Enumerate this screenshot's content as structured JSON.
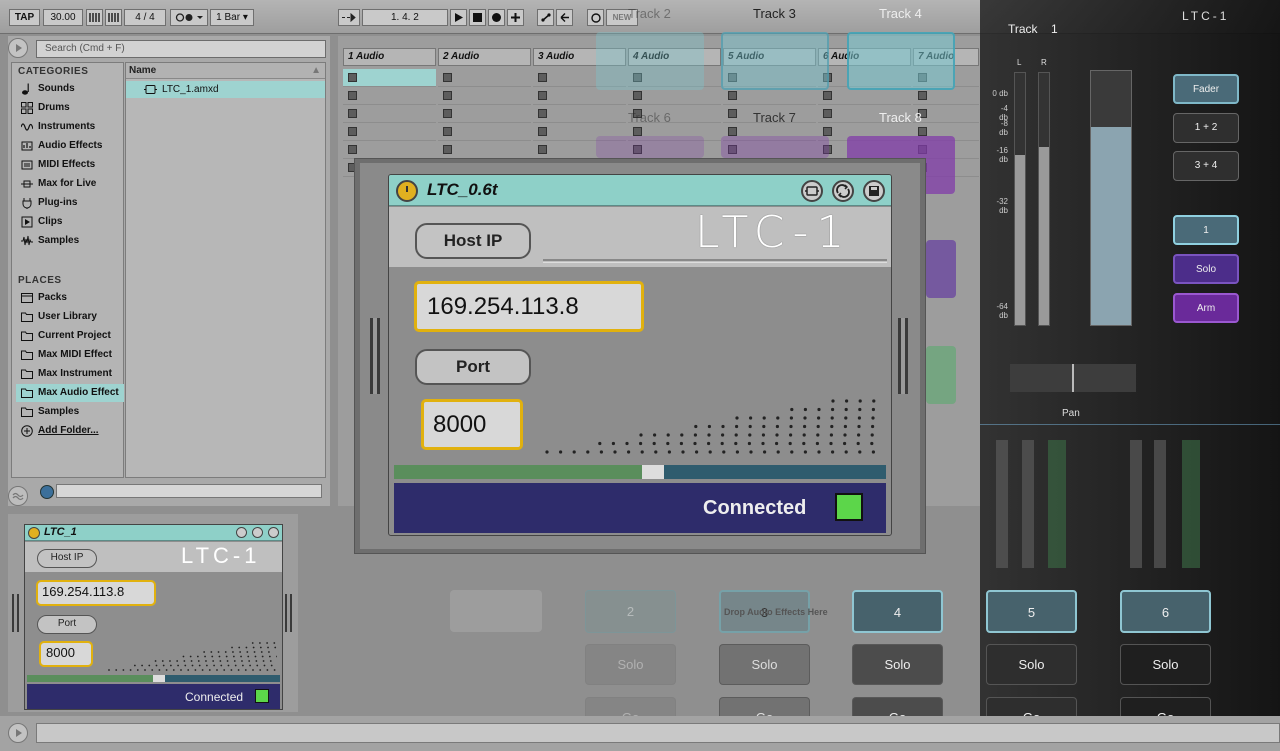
{
  "transport": {
    "tap": "TAP",
    "tempo": "30.00",
    "time_sig": "4 / 4",
    "quantize": "1 Bar",
    "position": "1.    4.    2"
  },
  "browser": {
    "search_placeholder": "Search (Cmd + F)",
    "categories_title": "CATEGORIES",
    "categories": [
      {
        "label": "Sounds",
        "icon": "note-icon"
      },
      {
        "label": "Drums",
        "icon": "drum-grid-icon"
      },
      {
        "label": "Instruments",
        "icon": "wave-icon"
      },
      {
        "label": "Audio Effects",
        "icon": "audio-effects-icon"
      },
      {
        "label": "MIDI Effects",
        "icon": "midi-effects-icon"
      },
      {
        "label": "Max for Live",
        "icon": "max-icon"
      },
      {
        "label": "Plug-ins",
        "icon": "plug-icon"
      },
      {
        "label": "Clips",
        "icon": "clip-icon"
      },
      {
        "label": "Samples",
        "icon": "sample-icon"
      }
    ],
    "places_title": "PLACES",
    "places": [
      {
        "label": "Packs"
      },
      {
        "label": "User Library"
      },
      {
        "label": "Current Project"
      },
      {
        "label": "Max MIDI Effect"
      },
      {
        "label": "Max Instrument"
      },
      {
        "label": "Max Audio Effect",
        "selected": true
      },
      {
        "label": "Samples"
      },
      {
        "label": "Add Folder..."
      }
    ],
    "name_column": "Name",
    "file": "LTC_1.amxd"
  },
  "session": {
    "tracks": [
      "1 Audio",
      "2 Audio",
      "3 Audio",
      "4 Audio",
      "5 Audio",
      "6 Audio",
      "7 Audio"
    ]
  },
  "overlay": {
    "track_labels": [
      "Track 2",
      "Track 3",
      "Track 4",
      "Track 6",
      "Track 7",
      "Track 8"
    ],
    "right_panel": {
      "track_label": "Track",
      "track_num": "1",
      "device_name": "LTC-1",
      "db_marks": [
        "0 db",
        "-4 db",
        "-8 db",
        "-16 db",
        "-32 db",
        "-64 db"
      ],
      "pan": "Pan",
      "buttons": [
        "Fader",
        "1 + 2",
        "3 + 4",
        "1",
        "Solo",
        "Arm"
      ]
    },
    "scene_numbers": [
      "2",
      "3",
      "4",
      "5",
      "6"
    ],
    "solo_label": "Solo",
    "go_label": "Go",
    "drop_hint": "Drop Audio Effects Here"
  },
  "device_big": {
    "title": "LTC_0.6t",
    "logo": "LTC-1",
    "host_label": "Host IP",
    "host_value": "169.254.113.8",
    "port_label": "Port",
    "port_value": "8000",
    "status": "Connected",
    "status_color": "#5cd64a",
    "header_color": "#8ed0c8"
  },
  "device_small": {
    "title": "LTC_1",
    "logo": "LTC-1",
    "host_label": "Host IP",
    "host_value": "169.254.113.8",
    "port_label": "Port",
    "port_value": "8000",
    "status": "Connected"
  }
}
